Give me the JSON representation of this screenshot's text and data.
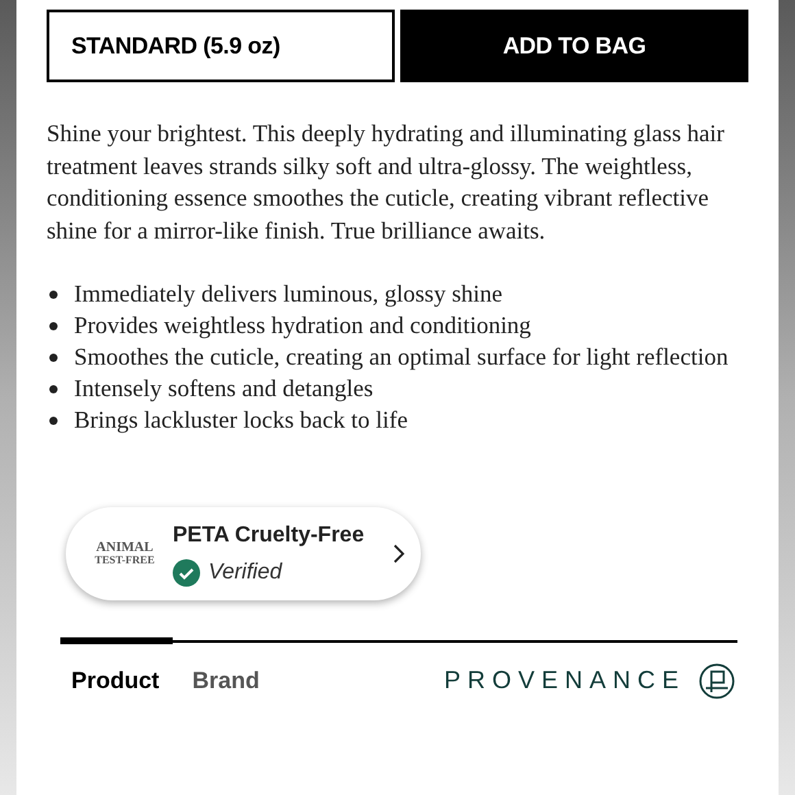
{
  "size_option": {
    "label": "STANDARD (5.9 oz)"
  },
  "add_button": {
    "label": "ADD TO BAG"
  },
  "description": "Shine your brightest. This deeply hydrating and illuminating glass hair treatment leaves strands silky soft and ultra-glossy. The weightless, conditioning essence smoothes the cuticle, creating vibrant reflective shine for a mirror-like finish. True brilliance awaits.",
  "benefits": [
    "Immediately delivers luminous, glossy shine",
    "Provides weightless hydration and conditioning",
    "Smoothes the cuticle, creating an optimal surface for light reflection",
    "Intensely softens and detangles",
    "Brings lackluster locks back to life"
  ],
  "certification": {
    "logo_lines": [
      "ANIMAL",
      "TEST-FREE"
    ],
    "title": "PETA Cruelty-Free",
    "status": "Verified",
    "verified": true
  },
  "tabs": [
    {
      "label": "Product",
      "selected": true
    },
    {
      "label": "Brand",
      "selected": false
    }
  ],
  "provenance": {
    "label": "PROVENANCE"
  }
}
